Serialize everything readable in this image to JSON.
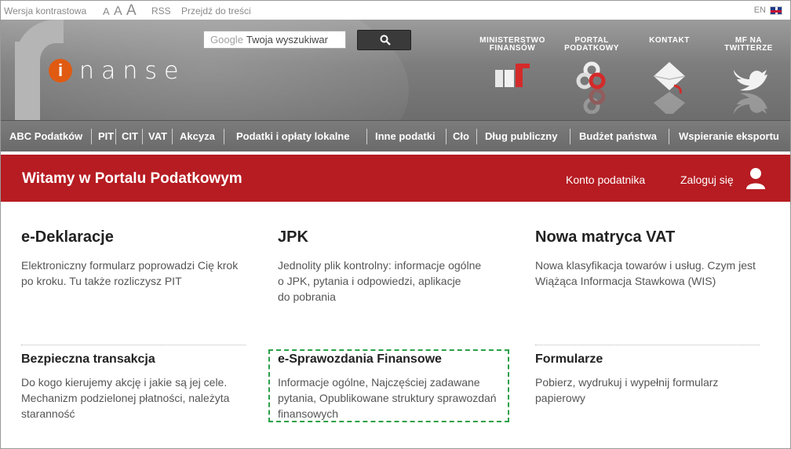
{
  "topbar": {
    "contrast": "Wersja kontrastowa",
    "font_sizes": [
      "A",
      "A",
      "A"
    ],
    "rss": "RSS",
    "skip": "Przejdź do treści",
    "lang": "EN"
  },
  "header": {
    "logo_i": "i",
    "logo_text": "nanse",
    "search_google": "Google",
    "search_placeholder": "Twoja wyszukiwar",
    "links": [
      {
        "label1": "MINISTERSTWO",
        "label2": "FINANSÓW"
      },
      {
        "label1": "PORTAL",
        "label2": "PODATKOWY"
      },
      {
        "label1": "KONTAKT",
        "label2": ""
      },
      {
        "label1": "MF NA",
        "label2": "TWITTERZE"
      }
    ]
  },
  "nav": {
    "items": [
      "ABC Podatków",
      "PIT",
      "CIT",
      "VAT",
      "Akcyza",
      "Podatki i opłaty lokalne",
      "Inne podatki",
      "Cło",
      "Dług publiczny",
      "Budżet państwa",
      "Wspieranie eksportu"
    ]
  },
  "banner": {
    "title": "Witamy w Portalu Podatkowym",
    "account": "Konto podatnika",
    "login": "Zaloguj się"
  },
  "cards": [
    {
      "title": "e-Deklaracje",
      "line1": "Elektroniczny formularz poprowadzi Cię krok",
      "line2": "po kroku. Tu także rozliczysz PIT",
      "line3": ""
    },
    {
      "title": "JPK",
      "line1": "Jednolity plik kontrolny: informacje ogólne",
      "line2": "o JPK, pytania i odpowiedzi, aplikacje",
      "line3": "do pobrania"
    },
    {
      "title": "Nowa matryca VAT",
      "line1": "Nowa klasyfikacja towarów i usług. Czym jest",
      "line2": "Wiążąca Informacja Stawkowa (WIS)",
      "line3": ""
    },
    {
      "title": "Bezpieczna transakcja",
      "line1": "Do kogo kierujemy akcję i jakie są jej cele.",
      "line2": "Mechanizm podzielonej płatności, należyta",
      "line3": "staranność"
    },
    {
      "title": "e-Sprawozdania Finansowe",
      "line1": "Informacje ogólne, Najczęściej zadawane",
      "line2": "pytania, Opublikowane struktury sprawozdań",
      "line3": "finansowych"
    },
    {
      "title": "Formularze",
      "line1": "Pobierz, wydrukuj i wypełnij formularz",
      "line2": "papierowy",
      "line3": ""
    }
  ],
  "colors": {
    "banner_red": "#b61c22",
    "header_gray": "#7d7d7d",
    "logo_orange": "#e05a12",
    "focus_green": "#2aa04a"
  }
}
